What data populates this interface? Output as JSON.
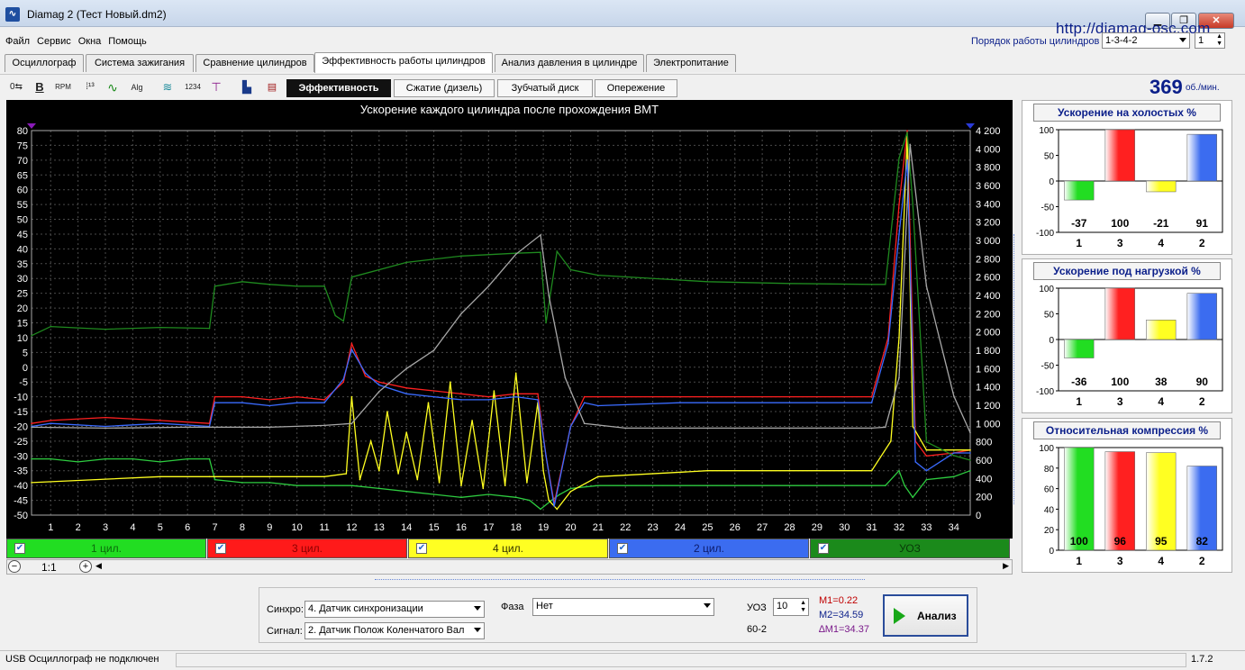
{
  "window": {
    "title": "Diamag 2 (Тест Новый.dm2)",
    "url": "http://diamag-osc.com",
    "app_icon": "waveform-icon"
  },
  "menu": [
    "Файл",
    "Сервис",
    "Окна",
    "Помощь"
  ],
  "firing_order": {
    "label": "Порядок работы цилиндров",
    "value": "1-3-4-2",
    "cyl_value": "1"
  },
  "main_tabs": [
    "Осциллограф",
    "Система зажигания",
    "Сравнение цилиндров",
    "Эффективность работы цилиндров",
    "Анализ давления в цилиндре",
    "Электропитание"
  ],
  "main_tab_active": 3,
  "sub_tabs": [
    "Эффективность",
    "Сжатие (дизель)",
    "Зубчатый диск",
    "Опережение"
  ],
  "sub_tab_active": 0,
  "rpm": {
    "value": "369",
    "unit": "об./мин."
  },
  "chart_data": {
    "type": "line",
    "title": "Ускорение каждого цилиндра после прохождения ВМТ",
    "x_ticks": [
      "1",
      "2",
      "3",
      "4",
      "5",
      "6",
      "7",
      "8",
      "9",
      "10",
      "11",
      "12",
      "13",
      "14",
      "15",
      "16",
      "17",
      "18",
      "19",
      "20",
      "21",
      "22",
      "23",
      "24",
      "25",
      "26",
      "27",
      "28",
      "29",
      "30",
      "31",
      "32",
      "33",
      "34"
    ],
    "y_left_ticks": [
      "80",
      "75",
      "70",
      "65",
      "60",
      "55",
      "50",
      "45",
      "40",
      "35",
      "30",
      "25",
      "20",
      "15",
      "10",
      "5",
      "0",
      "-5",
      "-10",
      "-15",
      "-20",
      "-25",
      "-30",
      "-35",
      "-40",
      "-45",
      "-50"
    ],
    "y_right_ticks": [
      "4 200",
      "4 000",
      "3 800",
      "3 600",
      "3 400",
      "3 200",
      "3 000",
      "2 800",
      "2 600",
      "2 400",
      "2 200",
      "2 000",
      "1 800",
      "1 600",
      "1 400",
      "1 200",
      "1 000",
      "800",
      "600",
      "400",
      "200",
      "0"
    ],
    "ylim_left": [
      -50,
      80
    ],
    "ylim_right": [
      0,
      4200
    ],
    "xlim": [
      0.3,
      34.6
    ],
    "grid": true,
    "series": [
      {
        "name": "1 цил.",
        "color": "#2ecc40",
        "x": [
          0.3,
          1,
          2,
          3,
          4,
          5,
          6,
          6.8,
          7,
          8,
          9,
          10,
          11,
          12,
          13,
          14,
          15,
          16,
          17,
          18,
          18.5,
          18.9,
          19.3,
          19.6,
          20,
          21,
          25,
          28,
          31,
          31.5,
          32,
          32.2,
          32.5,
          33,
          34,
          34.6
        ],
        "y": [
          -31,
          -31,
          -32,
          -31,
          -31,
          -32,
          -31,
          -31,
          -38,
          -39,
          -39,
          -40,
          -40,
          -40,
          -41,
          -42,
          -43,
          -44,
          -43,
          -44,
          -45,
          -48,
          -45,
          -43,
          -41,
          -40,
          -40,
          -40,
          -40,
          -40,
          -35,
          -40,
          -44,
          -38,
          -37,
          -35
        ]
      },
      {
        "name": "3 цил.",
        "color": "#ff2020",
        "x": [
          0.3,
          1,
          3,
          5,
          6.8,
          7,
          8,
          9,
          10,
          11,
          11.7,
          12,
          12.5,
          13,
          14,
          15,
          16,
          17,
          18,
          18.8,
          19.1,
          19.4,
          20,
          20.5,
          21,
          24,
          28,
          31,
          31.6,
          32,
          32.3,
          32.6,
          33,
          34,
          34.6
        ],
        "y": [
          -19,
          -18,
          -17,
          -18,
          -19,
          -10,
          -10,
          -11,
          -10,
          -11,
          -5,
          8,
          -3,
          -5,
          -7,
          -8,
          -9,
          -10,
          -9,
          -9,
          -30,
          -46,
          -20,
          -10,
          -10,
          -10,
          -10,
          -10,
          10,
          55,
          80,
          -25,
          -30,
          -29,
          -28
        ]
      },
      {
        "name": "4 цил.",
        "color": "#ffff20",
        "x": [
          0.3,
          5,
          6.8,
          7,
          8,
          9,
          10,
          11,
          11.8,
          12,
          12.3,
          12.7,
          13,
          13.3,
          13.7,
          14,
          14.4,
          14.8,
          15.2,
          15.6,
          16,
          16.4,
          16.8,
          17.2,
          17.6,
          18,
          18.4,
          18.8,
          19,
          19.2,
          19.5,
          20,
          21,
          25,
          28,
          31,
          31.7,
          32,
          32.3,
          32.5,
          33,
          34,
          34.6
        ],
        "y": [
          -39,
          -37,
          -37,
          -37,
          -37,
          -37,
          -37,
          -37,
          -36,
          -10,
          -38,
          -25,
          -35,
          -15,
          -36,
          -22,
          -38,
          -12,
          -39,
          -5,
          -40,
          -18,
          -41,
          -8,
          -40,
          -2,
          -39,
          -12,
          -35,
          -45,
          -48,
          -42,
          -37,
          -35,
          -35,
          -35,
          -25,
          10,
          78,
          -20,
          -28,
          -28,
          -28
        ]
      },
      {
        "name": "2 цил.",
        "color": "#3a6bff",
        "x": [
          0.3,
          1,
          3,
          5,
          6.8,
          7,
          8,
          9,
          10,
          11,
          11.7,
          12,
          12.5,
          13,
          14,
          15,
          16,
          17,
          18,
          18.8,
          19.1,
          19.4,
          20,
          20.5,
          21,
          24,
          28,
          31,
          31.6,
          32,
          32.3,
          32.6,
          33,
          34,
          34.6
        ],
        "y": [
          -20,
          -19,
          -20,
          -19,
          -20,
          -12,
          -12,
          -13,
          -12,
          -12,
          -4,
          6,
          -2,
          -6,
          -9,
          -10,
          -11,
          -11,
          -10,
          -11,
          -30,
          -47,
          -20,
          -12,
          -13,
          -12,
          -12,
          -12,
          8,
          45,
          70,
          -32,
          -35,
          -29,
          -29
        ]
      },
      {
        "name": "УОЗ",
        "color": "#1f8a1f",
        "axis": "right",
        "x": [
          0.3,
          1,
          3,
          5,
          6.8,
          7,
          8,
          9,
          10,
          11,
          11.4,
          11.7,
          12,
          14,
          16,
          18,
          18.9,
          19.1,
          19.5,
          20,
          21,
          25,
          28,
          31,
          31.5,
          32,
          32.3,
          32.5,
          33,
          34,
          34.6
        ],
        "y": [
          1960,
          2060,
          2030,
          2050,
          2040,
          2500,
          2550,
          2520,
          2500,
          2500,
          2180,
          2120,
          2600,
          2760,
          2830,
          2860,
          2870,
          2100,
          2880,
          2680,
          2620,
          2550,
          2530,
          2520,
          2520,
          3900,
          4180,
          3400,
          800,
          650,
          600
        ]
      },
      {
        "name": "об/мин",
        "color": "#a8a8a8",
        "axis": "right",
        "x": [
          0.3,
          3,
          6,
          6.8,
          9,
          11,
          12,
          13,
          14,
          15,
          16,
          17,
          18,
          18.9,
          19.2,
          19.8,
          20.5,
          22,
          25,
          28,
          31,
          31.5,
          32,
          32.4,
          33,
          34,
          34.6
        ],
        "y": [
          960,
          950,
          960,
          960,
          960,
          980,
          1000,
          1350,
          1600,
          1800,
          2200,
          2500,
          2850,
          3060,
          2400,
          1500,
          1000,
          950,
          950,
          950,
          950,
          960,
          1500,
          4050,
          2500,
          1300,
          900
        ]
      }
    ]
  },
  "legend": [
    {
      "label": "1 цил.",
      "color": "#22dd22",
      "text_color": "#0b6a0b"
    },
    {
      "label": "3 цил.",
      "color": "#ff1a1a",
      "text_color": "#8a0000"
    },
    {
      "label": "4 цил.",
      "color": "#ffff22",
      "text_color": "#333300"
    },
    {
      "label": "2 цил.",
      "color": "#3b6cf0",
      "text_color": "#0b1a6a"
    },
    {
      "label": "УОЗ",
      "color": "#1b8a1b",
      "text_color": "#083a08"
    }
  ],
  "zoom": {
    "label": "1:1"
  },
  "right_panels": [
    {
      "title": "Ускорение на холостых %",
      "y_ticks": [
        "100",
        "50",
        "0",
        "-50",
        "-100"
      ],
      "cylinders": [
        "1",
        "3",
        "4",
        "2"
      ],
      "values": [
        -37,
        100,
        -21,
        91
      ],
      "labels": [
        "-37",
        "100",
        "-21",
        "91"
      ],
      "colors": [
        "#22dd22",
        "#ff2020",
        "#ffff22",
        "#3b6cf0"
      ],
      "ylim": [
        -100,
        100
      ]
    },
    {
      "title": "Ускорение под нагрузкой %",
      "y_ticks": [
        "100",
        "50",
        "0",
        "-50",
        "-100"
      ],
      "cylinders": [
        "1",
        "3",
        "4",
        "2"
      ],
      "values": [
        -36,
        100,
        38,
        90
      ],
      "labels": [
        "-36",
        "100",
        "38",
        "90"
      ],
      "colors": [
        "#22dd22",
        "#ff2020",
        "#ffff22",
        "#3b6cf0"
      ],
      "ylim": [
        -100,
        100
      ]
    },
    {
      "title": "Относительная компрессия %",
      "y_ticks": [
        "100",
        "80",
        "60",
        "40",
        "20",
        "0"
      ],
      "cylinders": [
        "1",
        "3",
        "4",
        "2"
      ],
      "values": [
        100,
        96,
        95,
        82
      ],
      "labels": [
        "100",
        "96",
        "95",
        "82"
      ],
      "colors": [
        "#22dd22",
        "#ff2020",
        "#ffff22",
        "#3b6cf0"
      ],
      "ylim": [
        0,
        100
      ]
    }
  ],
  "controls": {
    "sync_label": "Синхро:",
    "sync_value": "4.  Датчик синхронизации",
    "signal_label": "Сигнал:",
    "signal_value": "2.  Датчик Полож Коленчатого Вал",
    "phase_label": "Фаза",
    "phase_value": "Нет",
    "uoz_label": "УОЗ",
    "uoz_value": "10",
    "uoz_sub": "60-2",
    "m1": "M1=0.22",
    "m2": "M2=34.59",
    "dm": "∆M1=34.37",
    "analyze_label": "Анализ"
  },
  "status": {
    "left": "USB Осциллограф не подключен",
    "version": "1.7.2"
  }
}
